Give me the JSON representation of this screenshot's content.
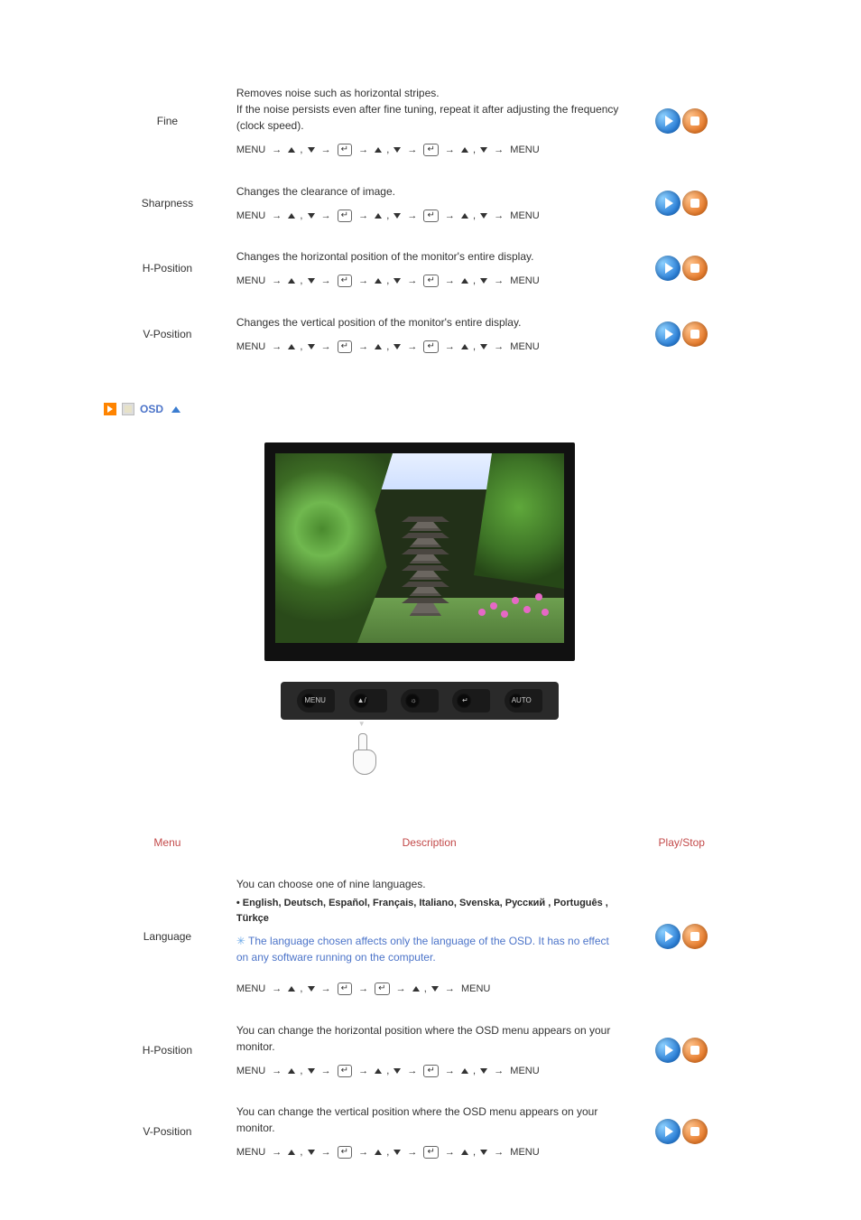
{
  "image_table": {
    "rows": [
      {
        "menu": "Fine",
        "desc_lines": [
          "Removes noise such as horizontal stripes.",
          "If the noise persists even after fine tuning, repeat it after adjusting the frequency (clock speed)."
        ],
        "nav": "MENU → ▲ , ▼ → ↵ → ▲ , ▼ → ↵ → ▲ , ▼ → MENU"
      },
      {
        "menu": "Sharpness",
        "desc_lines": [
          "Changes the clearance of image."
        ],
        "nav": "MENU → ▲ , ▼ → ↵ → ▲ , ▼ → ↵ → ▲ , ▼ → MENU"
      },
      {
        "menu": "H-Position",
        "desc_lines": [
          "Changes the horizontal position of the monitor's entire display."
        ],
        "nav": "MENU → ▲ , ▼ → ↵ → ▲ , ▼ → ↵ → ▲ , ▼ → MENU"
      },
      {
        "menu": "V-Position",
        "desc_lines": [
          "Changes the vertical position of the monitor's entire display."
        ],
        "nav": "MENU → ▲ , ▼ → ↵ → ▲ , ▼ → ↵ → ▲ , ▼ → MENU"
      }
    ]
  },
  "osd_section": {
    "label": "OSD",
    "buttons_bar": [
      "MENU",
      "▲/▼",
      "−/+",
      "↵",
      "AUTO"
    ],
    "headers": {
      "menu": "Menu",
      "desc": "Description",
      "play": "Play/Stop"
    },
    "rows": [
      {
        "menu": "Language",
        "desc_lines": [
          "You can choose one of nine languages."
        ],
        "lang_list": "• English, Deutsch, Español, Français, Italiano, Svenska, Русский , Português , Türkçe",
        "note": "The language chosen affects only the language of the OSD. It has no effect on any software running on the computer.",
        "nav": "MENU → ▲ , ▼ → ↵ → ↵ → ▲ , ▼ → MENU"
      },
      {
        "menu": "H-Position",
        "desc_lines": [
          "You can change the horizontal position where the OSD menu appears on your monitor."
        ],
        "nav": "MENU → ▲ , ▼ → ↵ → ▲ , ▼ → ↵ → ▲ , ▼ → MENU"
      },
      {
        "menu": "V-Position",
        "desc_lines": [
          "You can change the vertical position where the OSD menu appears on your monitor."
        ],
        "nav": "MENU → ▲ , ▼ → ↵ → ▲ , ▼ → ↵ → ▲ , ▼ → MENU"
      }
    ]
  }
}
